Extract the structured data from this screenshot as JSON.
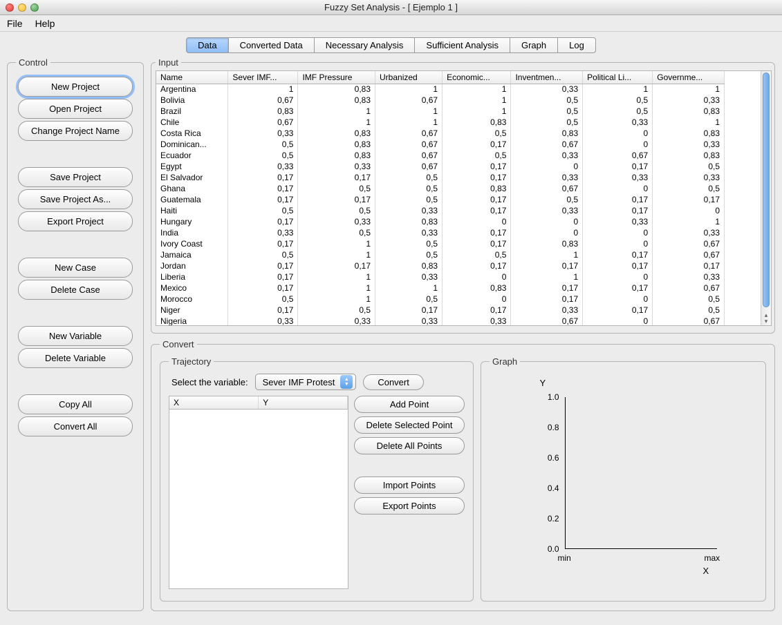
{
  "window": {
    "title": "Fuzzy Set Analysis - [ Ejemplo 1 ]"
  },
  "menu": {
    "file": "File",
    "help": "Help"
  },
  "tabs": {
    "data": "Data",
    "converted": "Converted Data",
    "necessary": "Necessary Analysis",
    "sufficient": "Sufficient Analysis",
    "graph": "Graph",
    "log": "Log"
  },
  "control": {
    "legend": "Control",
    "new_project": "New Project",
    "open_project": "Open Project",
    "change_name": "Change Project Name",
    "save_project": "Save Project",
    "save_as": "Save Project As...",
    "export_project": "Export Project",
    "new_case": "New Case",
    "delete_case": "Delete Case",
    "new_variable": "New Variable",
    "delete_variable": "Delete Variable",
    "copy_all": "Copy All",
    "convert_all": "Convert All"
  },
  "input": {
    "legend": "Input",
    "headers": [
      "Name",
      "Sever IMF...",
      "IMF Pressure",
      "Urbanized",
      "Economic...",
      "Inventmen...",
      "Political Li...",
      "Governme..."
    ],
    "rows": [
      [
        "Argentina",
        "1",
        "0,83",
        "1",
        "1",
        "0,33",
        "1",
        "1"
      ],
      [
        "Bolivia",
        "0,67",
        "0,83",
        "0,67",
        "1",
        "0,5",
        "0,5",
        "0,33"
      ],
      [
        "Brazil",
        "0,83",
        "1",
        "1",
        "1",
        "0,5",
        "0,5",
        "0,83"
      ],
      [
        "Chile",
        "0,67",
        "1",
        "1",
        "0,83",
        "0,5",
        "0,33",
        "1"
      ],
      [
        "Costa Rica",
        "0,33",
        "0,83",
        "0,67",
        "0,5",
        "0,83",
        "0",
        "0,83"
      ],
      [
        "Dominican...",
        "0,5",
        "0,83",
        "0,67",
        "0,17",
        "0,67",
        "0",
        "0,33"
      ],
      [
        "Ecuador",
        "0,5",
        "0,83",
        "0,67",
        "0,5",
        "0,33",
        "0,67",
        "0,83"
      ],
      [
        "Egypt",
        "0,33",
        "0,33",
        "0,67",
        "0,17",
        "0",
        "0,17",
        "0,5"
      ],
      [
        "El Salvador",
        "0,17",
        "0,17",
        "0,5",
        "0,17",
        "0,33",
        "0,33",
        "0,33"
      ],
      [
        "Ghana",
        "0,17",
        "0,5",
        "0,5",
        "0,83",
        "0,67",
        "0",
        "0,5"
      ],
      [
        "Guatemala",
        "0,17",
        "0,17",
        "0,5",
        "0,17",
        "0,5",
        "0,17",
        "0,17"
      ],
      [
        "Haiti",
        "0,5",
        "0,5",
        "0,33",
        "0,17",
        "0,33",
        "0,17",
        "0"
      ],
      [
        "Hungary",
        "0,17",
        "0,33",
        "0,83",
        "0",
        "0",
        "0,33",
        "1"
      ],
      [
        "India",
        "0,33",
        "0,5",
        "0,33",
        "0,17",
        "0",
        "0",
        "0,33"
      ],
      [
        "Ivory Coast",
        "0,17",
        "1",
        "0,5",
        "0,17",
        "0,83",
        "0",
        "0,67"
      ],
      [
        "Jamaica",
        "0,5",
        "1",
        "0,5",
        "0,5",
        "1",
        "0,17",
        "0,67"
      ],
      [
        "Jordan",
        "0,17",
        "0,17",
        "0,83",
        "0,17",
        "0,17",
        "0,17",
        "0,17"
      ],
      [
        "Liberia",
        "0,17",
        "1",
        "0,33",
        "0",
        "1",
        "0",
        "0,33"
      ],
      [
        "Mexico",
        "0,17",
        "1",
        "1",
        "0,83",
        "0,17",
        "0,17",
        "0,67"
      ],
      [
        "Morocco",
        "0,5",
        "1",
        "0,5",
        "0",
        "0,17",
        "0",
        "0,5"
      ],
      [
        "Niger",
        "0,17",
        "0,5",
        "0,17",
        "0,17",
        "0,33",
        "0,17",
        "0,5"
      ],
      [
        "Nigeria",
        "0,33",
        "0,33",
        "0,33",
        "0,33",
        "0,67",
        "0",
        "0,67"
      ]
    ]
  },
  "convert": {
    "legend": "Convert",
    "trajectory": {
      "legend": "Trajectory",
      "select_label": "Select the variable:",
      "selected": "Sever IMF Protest",
      "convert_btn": "Convert",
      "xy_headers": {
        "x": "X",
        "y": "Y"
      },
      "add_point": "Add Point",
      "delete_selected": "Delete Selected Point",
      "delete_all": "Delete All Points",
      "import_points": "Import Points",
      "export_points": "Export Points"
    },
    "graph": {
      "legend": "Graph",
      "y_label": "Y",
      "x_label": "X",
      "yticks": [
        "1.0",
        "0.8",
        "0.6",
        "0.4",
        "0.2",
        "0.0"
      ],
      "xmin": "min",
      "xmax": "max"
    }
  },
  "chart_data": {
    "type": "line",
    "title": "",
    "xlabel": "X",
    "ylabel": "Y",
    "ylim": [
      0.0,
      1.0
    ],
    "yticks": [
      0.0,
      0.2,
      0.4,
      0.6,
      0.8,
      1.0
    ],
    "x_categories": [
      "min",
      "max"
    ],
    "series": []
  }
}
